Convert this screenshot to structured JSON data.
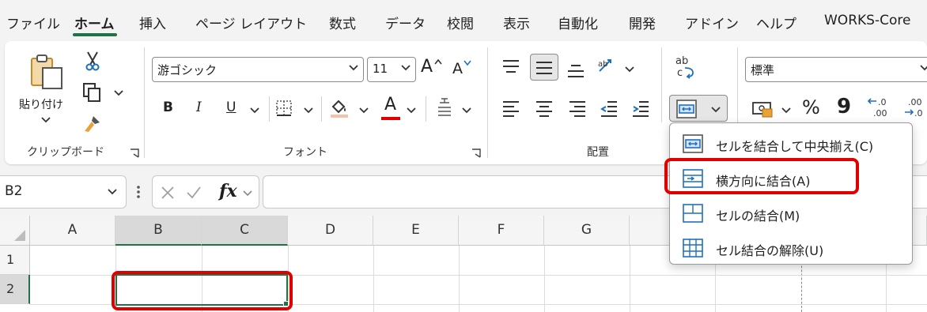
{
  "tabs": [
    {
      "label": "ファイル"
    },
    {
      "label": "ホーム"
    },
    {
      "label": "挿入"
    },
    {
      "label": "ページ レイアウト"
    },
    {
      "label": "数式"
    },
    {
      "label": "データ"
    },
    {
      "label": "校閲"
    },
    {
      "label": "表示"
    },
    {
      "label": "自動化"
    },
    {
      "label": "開発"
    },
    {
      "label": "アドイン"
    },
    {
      "label": "ヘルプ"
    },
    {
      "label": "WORKS-Core"
    }
  ],
  "ribbon": {
    "clipboard": {
      "paste_label": "貼り付け",
      "group_label": "クリップボード"
    },
    "font": {
      "font_name": "游ゴシック",
      "font_size": "11",
      "bold": "B",
      "italic": "I",
      "underline": "U",
      "font_color_glyph": "A",
      "grow_glyph": "A",
      "shrink_glyph": "A",
      "group_label": "フォント"
    },
    "alignment": {
      "group_label": "配置",
      "wrap_glyph_top": "ab",
      "wrap_glyph_bottom": "c"
    },
    "number": {
      "format": "標準",
      "percent": "%",
      "comma": "9"
    }
  },
  "formula_bar": {
    "name_box": "B2",
    "fx": "fx"
  },
  "grid": {
    "columns": [
      "A",
      "B",
      "C",
      "D",
      "E",
      "F",
      "G"
    ],
    "rows": [
      "1",
      "2"
    ],
    "selected_cell": "B2"
  },
  "merge_menu": {
    "items": [
      {
        "label": "セルを結合して中央揃え(C)"
      },
      {
        "label": "横方向に結合(A)"
      },
      {
        "label": "セルの結合(M)"
      },
      {
        "label": "セル結合の解除(U)"
      }
    ]
  },
  "colors": {
    "accent": "#217346",
    "highlight": "#e00000",
    "icon_blue": "#1f6fbf"
  }
}
